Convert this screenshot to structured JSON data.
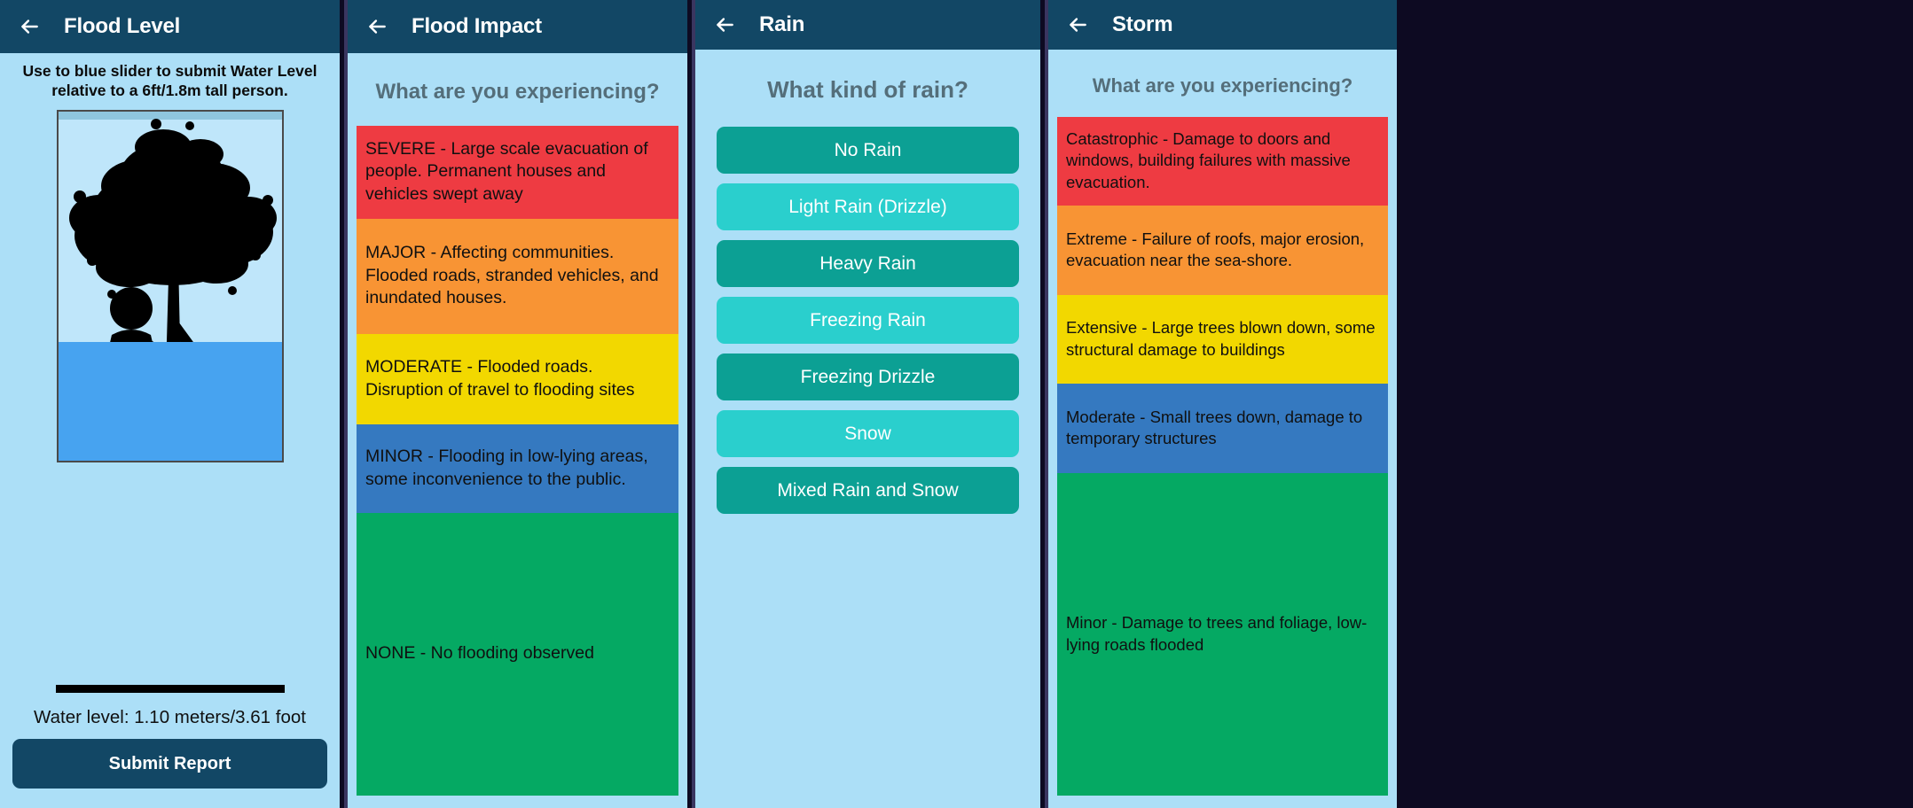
{
  "colors": {
    "appbar": "#124765",
    "page_bg": "#ACDFF7",
    "water_blue": "#47A3F0",
    "question_text": "#546E7A",
    "severity_red": "#EE3B42",
    "severity_orange": "#F89434",
    "severity_yellow": "#F2D800",
    "severity_blue": "#3579C0",
    "severity_green": "#05A963",
    "teal_dark": "#0CA094",
    "teal_light": "#2ACFCD"
  },
  "panels": [
    {
      "id": "flood-level",
      "appbar": {
        "title": "Flood Level",
        "back_icon": "arrow-left-icon"
      },
      "instructions": "Use to blue slider to submit Water Level relative to a 6ft/1.8m tall person.",
      "water_readout": "Water level: 1.10 meters/3.61 foot",
      "water_fill_percent": 34,
      "submit_label": "Submit Report"
    },
    {
      "id": "flood-impact",
      "appbar": {
        "title": "Flood Impact",
        "back_icon": "arrow-left-icon"
      },
      "question": "What are you experiencing?",
      "options": [
        {
          "text": "SEVERE - Large scale evacuation of people. Permanent houses and vehicles swept away",
          "color": "#EE3B42"
        },
        {
          "text": "MAJOR -  Affecting communities. Flooded roads, stranded vehicles, and inundated houses.",
          "color": "#F89434"
        },
        {
          "text": "MODERATE - Flooded roads. Disruption of travel to flooding sites",
          "color": "#F2D800"
        },
        {
          "text": "MINOR - Flooding in low-lying areas, some inconvenience to the public.",
          "color": "#3579C0"
        },
        {
          "text": "NONE - No flooding observed",
          "color": "#05A963"
        }
      ]
    },
    {
      "id": "rain",
      "appbar": {
        "title": "Rain",
        "back_icon": "arrow-left-icon"
      },
      "question": "What kind of rain?",
      "options": [
        {
          "label": "No Rain",
          "color": "#0CA094"
        },
        {
          "label": "Light Rain (Drizzle)",
          "color": "#2ACFCD"
        },
        {
          "label": "Heavy Rain",
          "color": "#0CA094"
        },
        {
          "label": "Freezing Rain",
          "color": "#2ACFCD"
        },
        {
          "label": "Freezing Drizzle",
          "color": "#0CA094"
        },
        {
          "label": "Snow",
          "color": "#2ACFCD"
        },
        {
          "label": "Mixed Rain and Snow",
          "color": "#0CA094"
        }
      ]
    },
    {
      "id": "storm",
      "appbar": {
        "title": "Storm",
        "back_icon": "arrow-left-icon"
      },
      "question": "What are you experiencing?",
      "options": [
        {
          "text": "Catastrophic - Damage to doors and windows, building failures with massive evacuation.",
          "color": "#EE3B42"
        },
        {
          "text": "Extreme - Failure of roofs, major erosion, evacuation near the sea-shore.",
          "color": "#F89434"
        },
        {
          "text": "Extensive - Large trees blown down, some structural damage to buildings",
          "color": "#F2D800"
        },
        {
          "text": "Moderate - Small trees down, damage to temporary structures",
          "color": "#3579C0"
        },
        {
          "text": "Minor - Damage to trees and foliage, low-lying roads flooded",
          "color": "#05A963"
        }
      ]
    }
  ]
}
